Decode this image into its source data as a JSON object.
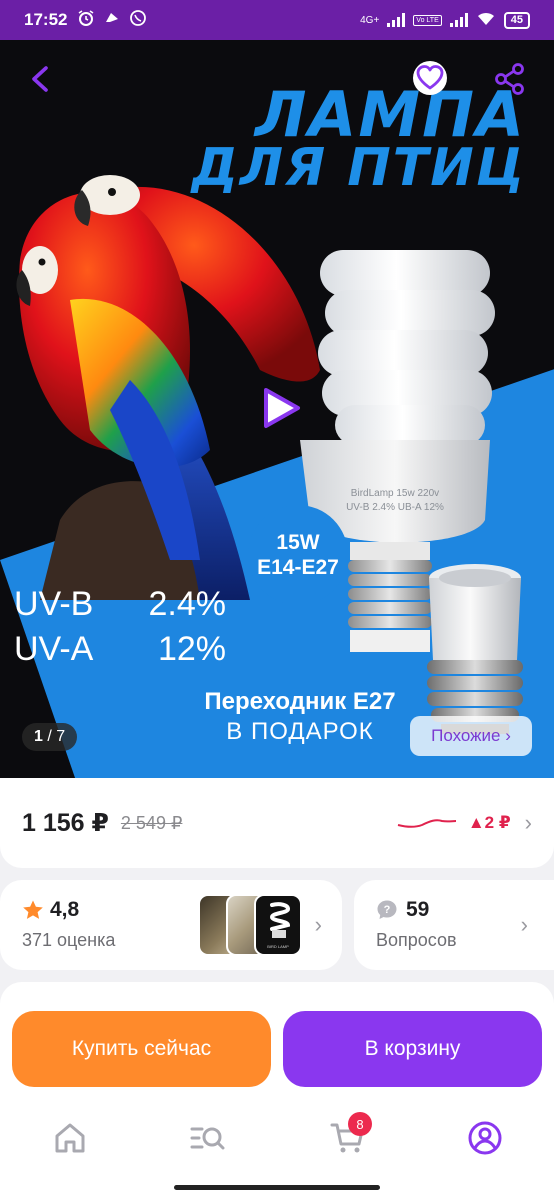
{
  "status_bar": {
    "time": "17:52",
    "network": "4G+",
    "lte": "Vo LTE",
    "battery": "45"
  },
  "hero": {
    "title_line1": "ЛАМПА",
    "title_line2": "ДЛЯ ПТИЦ",
    "badge_line1": "15W",
    "badge_line2": "E14-E27",
    "lamp_print_line1": "BirdLamp 15w 220v",
    "lamp_print_line2": "UV-B 2.4% UB-A 12%",
    "uv_b_label": "UV-B",
    "uv_b_value": "2.4%",
    "uv_a_label": "UV-A",
    "uv_a_value": "12%",
    "gift_line1": "Переходник E27",
    "gift_line2": "В ПОДАРОК",
    "pager_current": "1",
    "pager_total": "/ 7",
    "similar_label": "Похожие ›"
  },
  "price": {
    "current": "1 156 ₽",
    "old": "2 549 ₽",
    "delta": "▲2 ₽",
    "chevron": "›"
  },
  "rating": {
    "value": "4,8",
    "count_label": "371 оценка",
    "thumb_caption": "BIRD LAMP",
    "chevron": "›"
  },
  "questions": {
    "count": "59",
    "label": "Вопросов",
    "chevron": "›"
  },
  "actions": {
    "buy_now": "Купить сейчас",
    "add_to_cart": "В корзину"
  },
  "bottom_nav": {
    "cart_count": "8"
  },
  "colors": {
    "brand_purple": "#8a37ef",
    "buy_orange": "#ff8a2b",
    "price_delta_red": "#e0224d",
    "status_bar": "#6b1fa6",
    "hero_blue": "#1e86e0"
  }
}
